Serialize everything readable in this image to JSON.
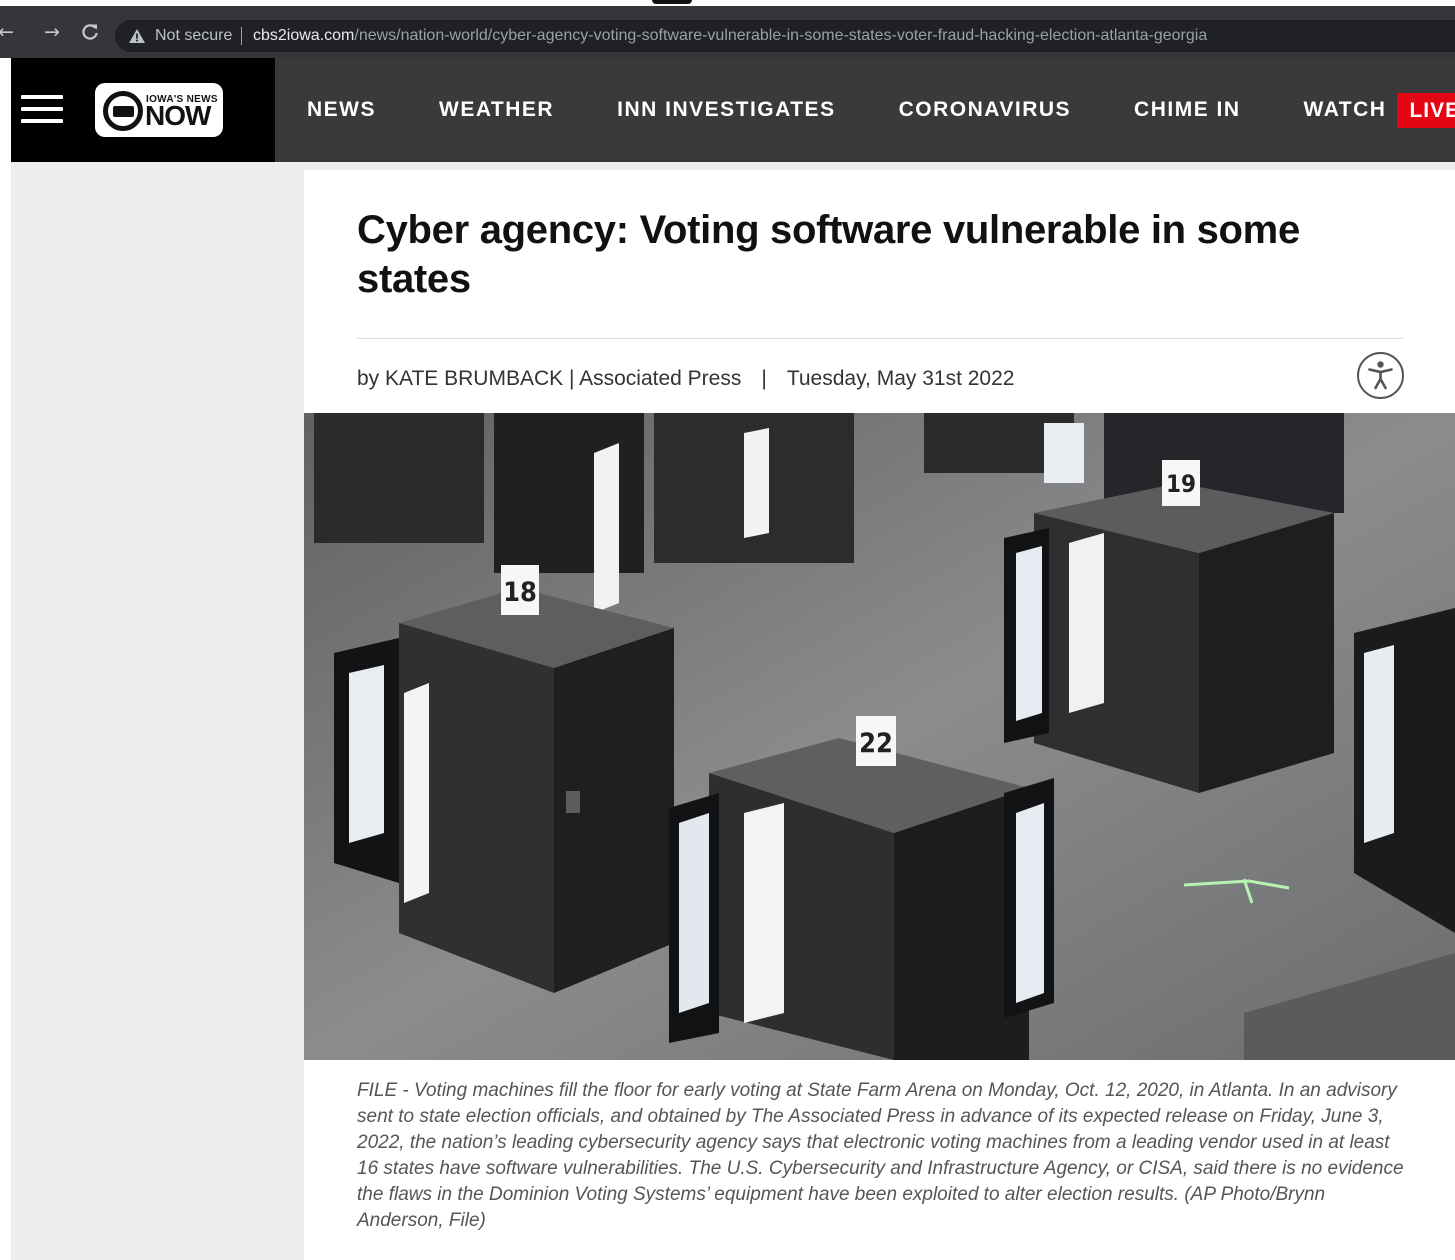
{
  "browser": {
    "security_label": "Not secure",
    "url_host": "cbs2iowa.com",
    "url_path": "/news/nation-world/cyber-agency-voting-software-vulnerable-in-some-states-voter-fraud-hacking-election-atlanta-georgia",
    "icons": [
      "back-arrow-icon",
      "forward-arrow-icon",
      "reload-icon",
      "warning-icon"
    ]
  },
  "header": {
    "logo_small": "IOWA'S NEWS",
    "logo_big": "NOW",
    "nav": [
      {
        "label": "NEWS"
      },
      {
        "label": "WEATHER"
      },
      {
        "label": "INN INVESTIGATES"
      },
      {
        "label": "CORONAVIRUS"
      },
      {
        "label": "CHIME IN"
      },
      {
        "label": "WATCH"
      }
    ],
    "live_badge": "LIVE",
    "colors": {
      "header_bg": "#3a3a3a",
      "brand_bg": "#000000",
      "live": "#e30613"
    }
  },
  "article": {
    "headline": "Cyber agency: Voting software vulnerable in some states",
    "byline": "by KATE BRUMBACK | Associated Press",
    "divider": "|",
    "date": "Tuesday, May 31st 2022",
    "photo_labels": [
      "18",
      "22",
      "19"
    ],
    "caption": "FILE - Voting machines fill the floor for early voting at State Farm Arena on Monday, Oct. 12, 2020, in Atlanta. In an advisory sent to state election officials, and obtained by The Associated Press in advance of its expected release on Friday, June 3, 2022, the nation’s leading cybersecurity agency says that electronic voting machines from a leading vendor used in at least 16 states have software vulnerabilities. The U.S. Cybersecurity and Infrastructure Agency, or CISA, said there is no evidence the flaws in the Dominion Voting Systems’ equipment have been exploited to alter election results. (AP Photo/Brynn Anderson, File)"
  }
}
